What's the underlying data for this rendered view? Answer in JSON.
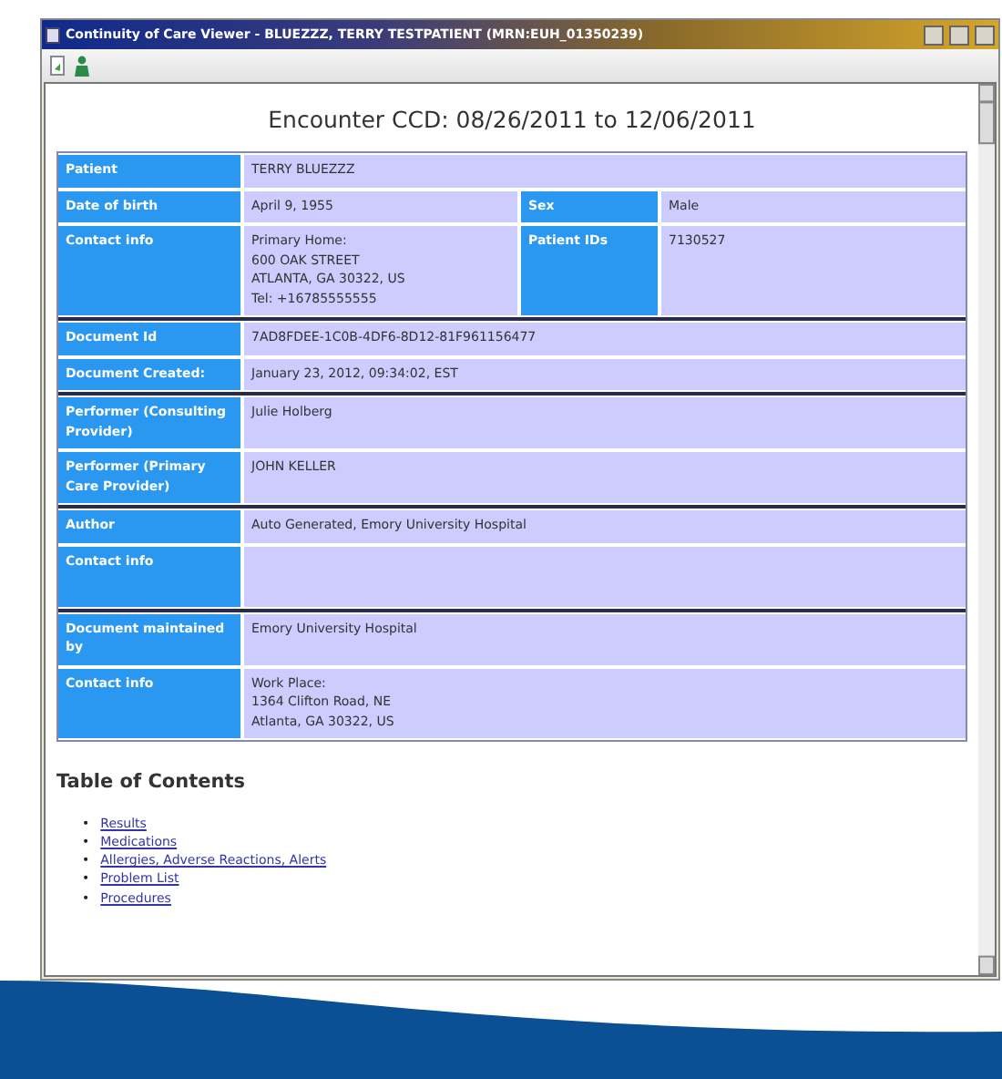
{
  "window": {
    "title": "Continuity of Care Viewer - BLUEZZZ, TERRY TESTPATIENT (MRN:EUH_01350239)"
  },
  "heading": "Encounter CCD: 08/26/2011 to 12/06/2011",
  "sections": [
    {
      "rows": [
        {
          "cells": [
            {
              "label": "Patient",
              "value": [
                "TERRY BLUEZZZ"
              ]
            }
          ]
        },
        {
          "cells": [
            {
              "label": "Date of birth",
              "value": [
                "April 9, 1955"
              ]
            },
            {
              "label": "Sex",
              "value": [
                "Male"
              ]
            }
          ]
        },
        {
          "cells": [
            {
              "label": "Contact info",
              "value": [
                "Primary Home:",
                "600 OAK STREET",
                "ATLANTA, GA 30322, US",
                "Tel: +16785555555"
              ]
            },
            {
              "label": "Patient IDs",
              "value": [
                "7130527"
              ]
            }
          ]
        }
      ]
    },
    {
      "rows": [
        {
          "cells": [
            {
              "label": "Document Id",
              "value": [
                "7AD8FDEE-1C0B-4DF6-8D12-81F961156477"
              ]
            }
          ]
        },
        {
          "cells": [
            {
              "label": "Document Created:",
              "value": [
                "January 23, 2012, 09:34:02, EST"
              ]
            }
          ]
        }
      ]
    },
    {
      "rows": [
        {
          "cells": [
            {
              "label": "Performer (Consulting Provider)",
              "value": [
                "Julie Holberg"
              ]
            }
          ]
        },
        {
          "cells": [
            {
              "label": "Performer (Primary Care Provider)",
              "value": [
                "JOHN KELLER"
              ]
            }
          ]
        }
      ]
    },
    {
      "rows": [
        {
          "cells": [
            {
              "label": "Author",
              "value": [
                "Auto Generated, Emory University Hospital"
              ]
            }
          ]
        },
        {
          "cells": [
            {
              "label": "Contact info"
            }
          ]
        }
      ]
    },
    {
      "rows": [
        {
          "cells": [
            {
              "label": "Document maintained by",
              "value": [
                "Emory University Hospital"
              ]
            }
          ]
        },
        {
          "cells": [
            {
              "label": "Contact info",
              "value": [
                "Work Place:",
                "1364 Clifton Road, NE",
                "Atlanta, GA 30322, US"
              ]
            }
          ]
        }
      ]
    }
  ],
  "toc": {
    "title": "Table of Contents",
    "items": [
      {
        "bullet": "•",
        "label": "Results"
      },
      {
        "bullet": "•",
        "label": "Medications"
      },
      {
        "bullet": "•",
        "label": "Allergies, Adverse Reactions, Alerts"
      },
      {
        "bullet": "•",
        "label": "Problem List"
      },
      {
        "bullet": "•",
        "label": "Procedures"
      }
    ]
  }
}
